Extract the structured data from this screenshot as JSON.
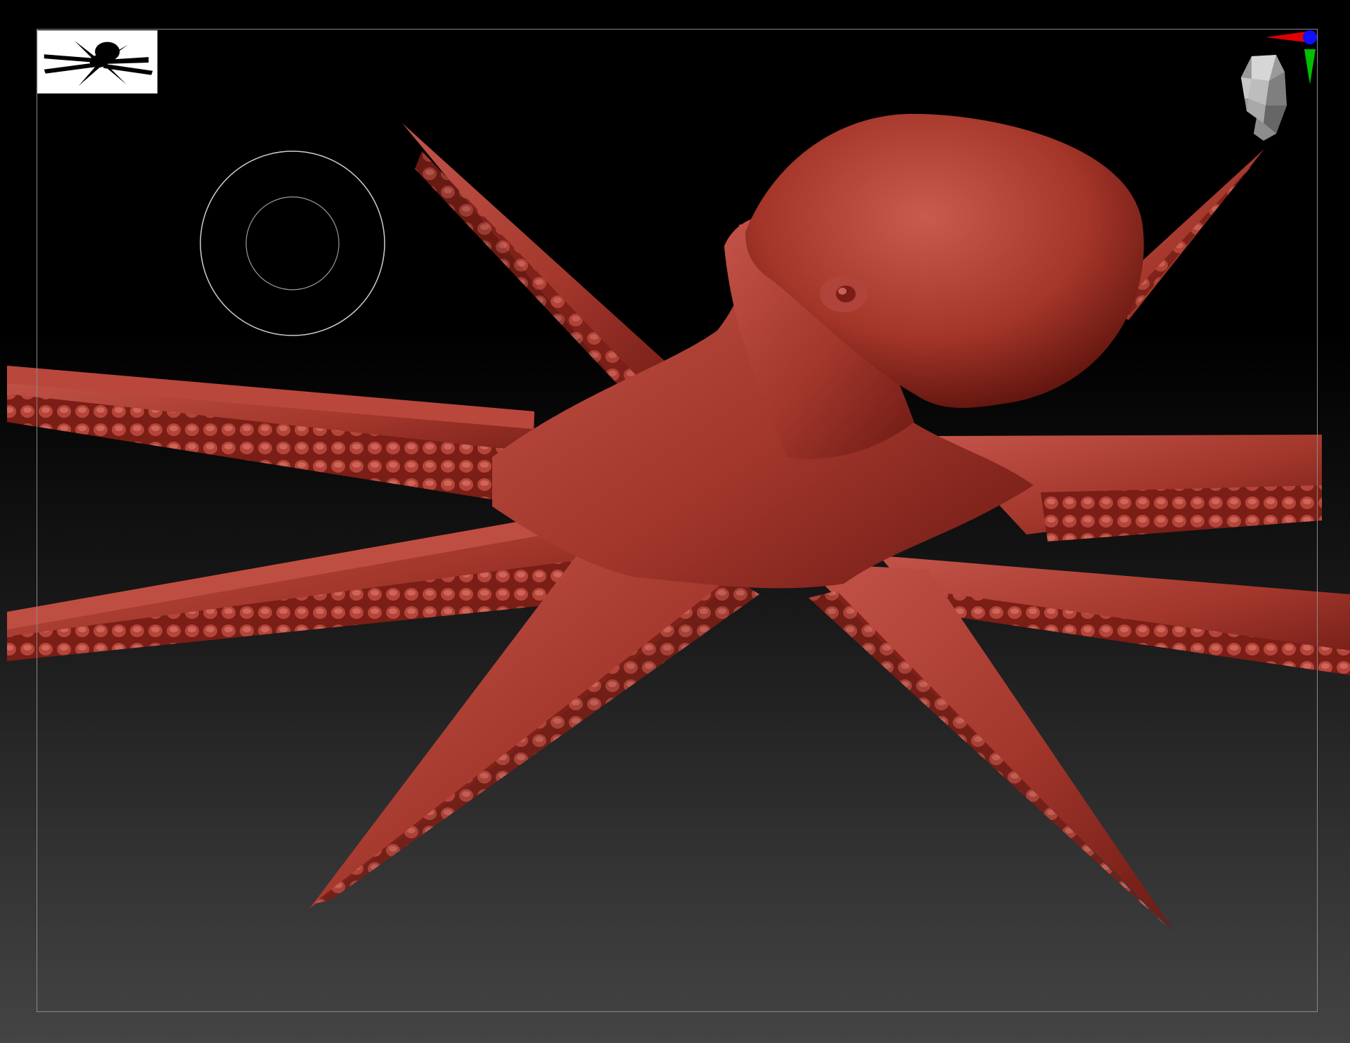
{
  "canvas": {
    "background_top": "#000000",
    "background_bottom": "#444444",
    "frame_color": "#8a8a8a"
  },
  "model": {
    "subject": "octopus",
    "skin_color": "#a3372c",
    "skin_shadow": "#5e1410",
    "skin_highlight": "#c8564a"
  },
  "thumbnail": {
    "icon": "octopus-silhouette-icon",
    "background": "#ffffff"
  },
  "brush": {
    "icon": "brush-cursor-icon",
    "color": "#cfcfcf"
  },
  "navigator": {
    "icon": "head-gizmo-icon",
    "axis_x_color": "#e00000",
    "axis_y_color": "#00c000",
    "axis_z_color": "#1010ff"
  }
}
